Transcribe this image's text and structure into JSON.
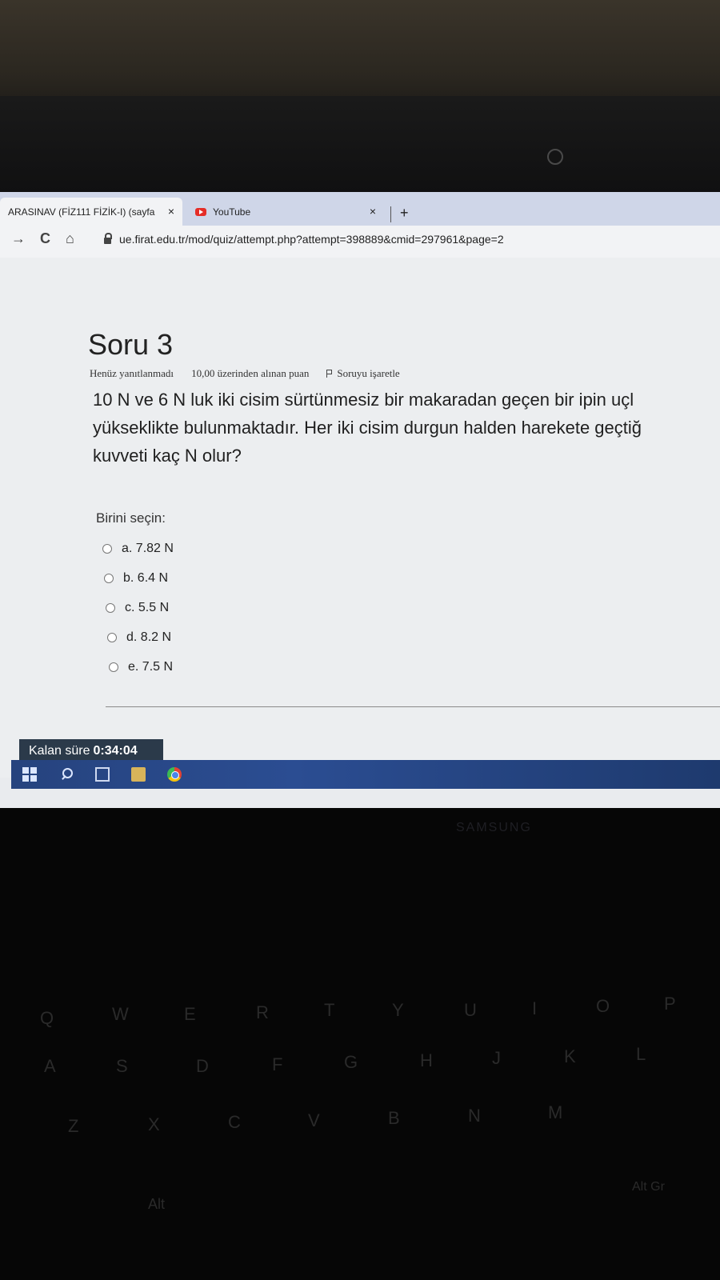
{
  "browser": {
    "tabs": [
      {
        "label": "ARASINAV (FİZ111 FİZİK-I) (sayfa",
        "active": true
      },
      {
        "label": "YouTube",
        "active": false
      }
    ],
    "tab_close_glyph": "×",
    "new_tab_glyph": "+",
    "url": "ue.firat.edu.tr/mod/quiz/attempt.php?attempt=398889&cmid=297961&page=2",
    "nav": {
      "forward": "→",
      "reload": "C",
      "home": "⌂"
    }
  },
  "quiz": {
    "question_title": "Soru 3",
    "status": "Henüz yanıtlanmadı",
    "points": "10,00 üzerinden alınan puan",
    "flag": "Soruyu işaretle",
    "question_lines": [
      "10 N ve 6 N luk iki cisim sürtünmesiz bir makaradan geçen bir ipin uçl",
      "yükseklikte bulunmaktadır. Her iki cisim durgun halden harekete geçtiğ",
      "kuvveti kaç N olur?"
    ],
    "prompt": "Birini seçin:",
    "answers": [
      "a. 7.82 N",
      "b. 6.4 N",
      "c. 5.5 N",
      "d. 8.2 N",
      "e. 7.5 N"
    ],
    "timer_label": "Kalan süre",
    "timer_value": "0:34:04"
  },
  "icons": {
    "taskbar": [
      "windows-icon",
      "search-icon",
      "task-view-icon",
      "file-explorer-icon",
      "chrome-icon"
    ]
  },
  "keyboard": {
    "brand": "SAMSUNG",
    "keys": [
      "Q",
      "W",
      "E",
      "R",
      "T",
      "Y",
      "U",
      "I",
      "O",
      "P",
      "A",
      "S",
      "D",
      "F",
      "G",
      "H",
      "J",
      "K",
      "L",
      "Z",
      "X",
      "C",
      "V",
      "B",
      "N",
      "M",
      "Alt",
      "Alt Gr"
    ]
  }
}
